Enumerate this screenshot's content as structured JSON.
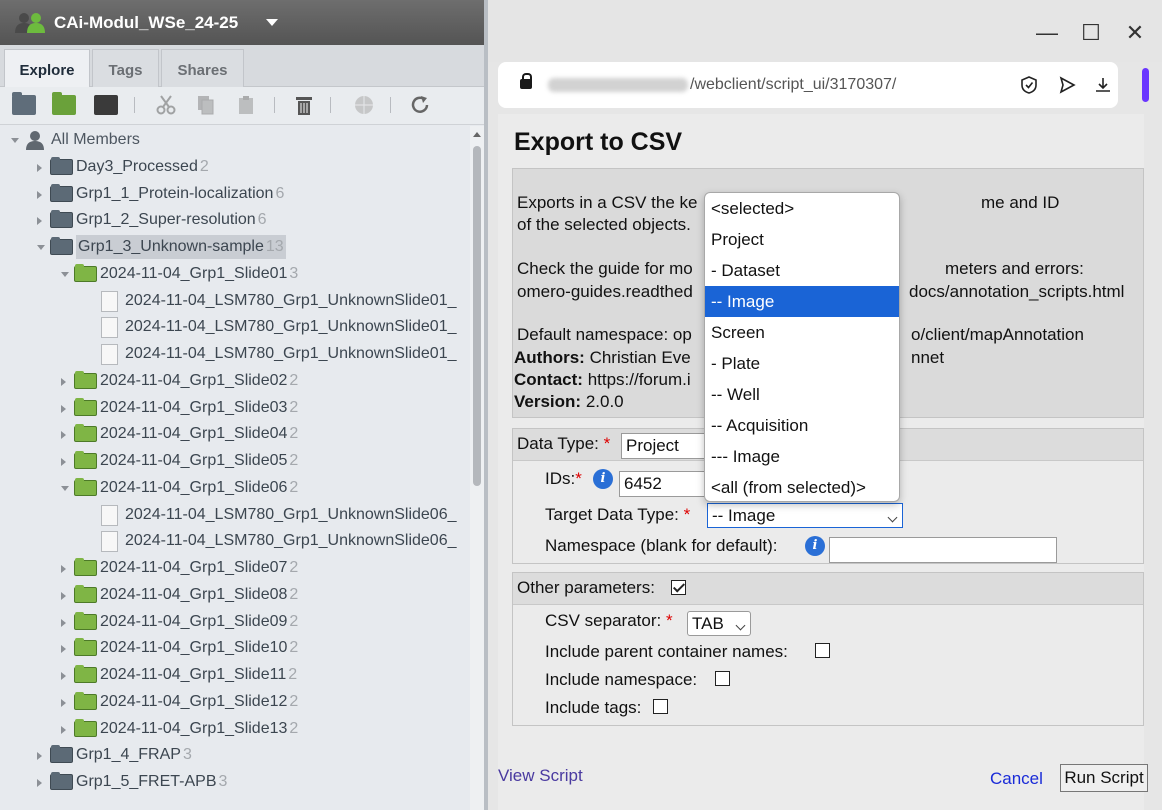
{
  "left_panel": {
    "group_name": "CAi-Modul_WSe_24-25",
    "tabs": [
      "Explore",
      "Tags",
      "Shares"
    ],
    "active_tab": "Explore",
    "toolbar_icons": [
      "project-folder-icon",
      "dataset-folder-icon",
      "screen-icon",
      "cut-icon",
      "copy-icon",
      "paste-icon",
      "delete-icon",
      "share-icon",
      "refresh-icon"
    ],
    "tree": [
      {
        "label": "All Members",
        "count": "",
        "kind": "members",
        "depth": 0,
        "expander": "open"
      },
      {
        "label": "Day3_Processed",
        "count": "2",
        "kind": "project",
        "depth": 1,
        "expander": "closed"
      },
      {
        "label": "Grp1_1_Protein-localization",
        "count": "6",
        "kind": "project",
        "depth": 1,
        "expander": "closed"
      },
      {
        "label": "Grp1_2_Super-resolution",
        "count": "6",
        "kind": "project",
        "depth": 1,
        "expander": "closed"
      },
      {
        "label": "Grp1_3_Unknown-sample",
        "count": "13",
        "kind": "project",
        "depth": 1,
        "expander": "open",
        "selected": true
      },
      {
        "label": "2024-11-04_Grp1_Slide01",
        "count": "3",
        "kind": "dataset",
        "depth": 2,
        "expander": "open"
      },
      {
        "label": "2024-11-04_LSM780_Grp1_UnknownSlide01_",
        "count": "",
        "kind": "image",
        "depth": 3,
        "expander": "none"
      },
      {
        "label": "2024-11-04_LSM780_Grp1_UnknownSlide01_",
        "count": "",
        "kind": "image",
        "depth": 3,
        "expander": "none"
      },
      {
        "label": "2024-11-04_LSM780_Grp1_UnknownSlide01_",
        "count": "",
        "kind": "image",
        "depth": 3,
        "expander": "none"
      },
      {
        "label": "2024-11-04_Grp1_Slide02",
        "count": "2",
        "kind": "dataset",
        "depth": 2,
        "expander": "closed"
      },
      {
        "label": "2024-11-04_Grp1_Slide03",
        "count": "2",
        "kind": "dataset",
        "depth": 2,
        "expander": "closed"
      },
      {
        "label": "2024-11-04_Grp1_Slide04",
        "count": "2",
        "kind": "dataset",
        "depth": 2,
        "expander": "closed"
      },
      {
        "label": "2024-11-04_Grp1_Slide05",
        "count": "2",
        "kind": "dataset",
        "depth": 2,
        "expander": "closed"
      },
      {
        "label": "2024-11-04_Grp1_Slide06",
        "count": "2",
        "kind": "dataset",
        "depth": 2,
        "expander": "open"
      },
      {
        "label": "2024-11-04_LSM780_Grp1_UnknownSlide06_",
        "count": "",
        "kind": "image",
        "depth": 3,
        "expander": "none"
      },
      {
        "label": "2024-11-04_LSM780_Grp1_UnknownSlide06_",
        "count": "",
        "kind": "image",
        "depth": 3,
        "expander": "none"
      },
      {
        "label": "2024-11-04_Grp1_Slide07",
        "count": "2",
        "kind": "dataset",
        "depth": 2,
        "expander": "closed"
      },
      {
        "label": "2024-11-04_Grp1_Slide08",
        "count": "2",
        "kind": "dataset",
        "depth": 2,
        "expander": "closed"
      },
      {
        "label": "2024-11-04_Grp1_Slide09",
        "count": "2",
        "kind": "dataset",
        "depth": 2,
        "expander": "closed"
      },
      {
        "label": "2024-11-04_Grp1_Slide10",
        "count": "2",
        "kind": "dataset",
        "depth": 2,
        "expander": "closed"
      },
      {
        "label": "2024-11-04_Grp1_Slide11",
        "count": "2",
        "kind": "dataset",
        "depth": 2,
        "expander": "closed"
      },
      {
        "label": "2024-11-04_Grp1_Slide12",
        "count": "2",
        "kind": "dataset",
        "depth": 2,
        "expander": "closed"
      },
      {
        "label": "2024-11-04_Grp1_Slide13",
        "count": "2",
        "kind": "dataset",
        "depth": 2,
        "expander": "closed"
      },
      {
        "label": "Grp1_4_FRAP",
        "count": "3",
        "kind": "project",
        "depth": 1,
        "expander": "closed"
      },
      {
        "label": "Grp1_5_FRET-APB",
        "count": "3",
        "kind": "project",
        "depth": 1,
        "expander": "closed"
      }
    ]
  },
  "browser": {
    "url_path": "/webclient/script_ui/3170307/",
    "window_controls": {
      "minimize": "—",
      "maximize": "☐",
      "close": "✕"
    },
    "address_icons": [
      "shield-icon",
      "send-icon",
      "download-icon"
    ]
  },
  "script": {
    "title": "Export to CSV",
    "description_lines": [
      "Exports in a CSV the ke",
      "me and ID",
      "of the selected objects.",
      "Check the guide for mo",
      "meters and errors:",
      "omero-guides.readthed",
      "docs/annotation_scripts.html",
      "Default namespace: op",
      "o/client/mapAnnotation"
    ],
    "authors_label": "Authors:",
    "authors_value": "Christian Eve",
    "authors_tail": "nnet",
    "contact_label": "Contact:",
    "contact_value": "https://forum.i",
    "version_label": "Version:",
    "version_value": "2.0.0"
  },
  "form": {
    "data_type_label": "Data Type:",
    "data_type_value": "Project",
    "ids_label": "IDs:",
    "ids_value": "6452",
    "target_label": "Target Data Type:",
    "target_value": "-- Image",
    "namespace_label": "Namespace (blank for default):",
    "namespace_value": "",
    "other_label": "Other parameters:",
    "other_checked": true,
    "csv_sep_label": "CSV separator:",
    "csv_sep_value": "TAB",
    "parent_label": "Include parent container names:",
    "parent_checked": false,
    "ns_label": "Include namespace:",
    "ns_checked": false,
    "tags_label": "Include tags:",
    "tags_checked": false,
    "required_mark": "*"
  },
  "footer": {
    "view_script": "View Script",
    "cancel": "Cancel",
    "run": "Run Script"
  },
  "dropdown": {
    "options": [
      "<selected>",
      "Project",
      "- Dataset",
      "-- Image",
      "Screen",
      "- Plate",
      "-- Well",
      "-- Acquisition",
      "--- Image",
      "<all (from selected)>"
    ],
    "active_index": 3,
    "accent_color": "#1a64d6"
  }
}
